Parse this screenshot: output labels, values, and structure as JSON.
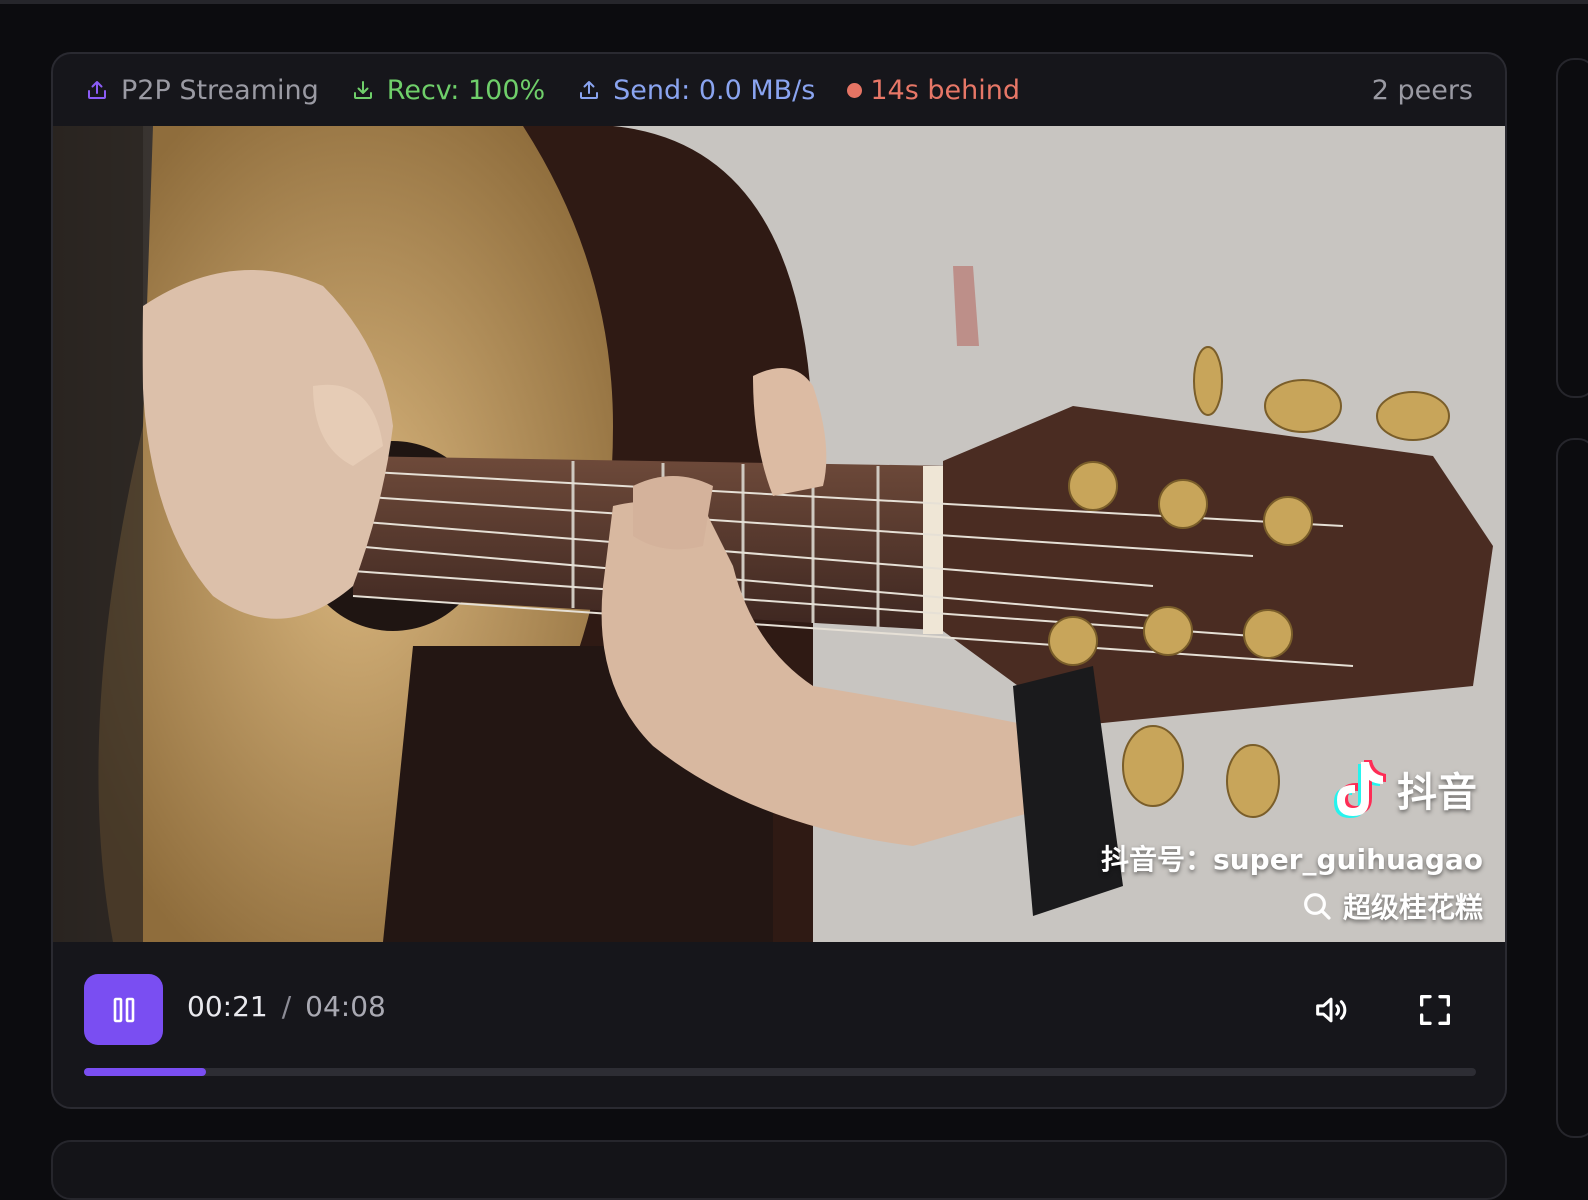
{
  "status": {
    "mode_label": "P2P Streaming",
    "recv_label": "Recv: 100%",
    "send_label": "Send: 0.0 MB/s",
    "lag_label": "14s behind",
    "peers_label": "2 peers",
    "colors": {
      "mode": "#9a9aa3",
      "recv": "#6fcf6a",
      "send": "#8aa4f0",
      "lag": "#e77767"
    }
  },
  "video": {
    "watermark_brand": "抖音",
    "watermark_id": "抖音号：super_guihuagao",
    "watermark_search": "超级桂花糕",
    "icons": [
      "tiktok-logo-icon",
      "search-icon"
    ]
  },
  "controls": {
    "current_time": "00:21",
    "separator": "/",
    "duration": "04:08",
    "progress_fraction": 0.088,
    "accent": "#7a4ef2",
    "icons": [
      "pause-icon",
      "volume-icon",
      "fullscreen-icon"
    ]
  }
}
